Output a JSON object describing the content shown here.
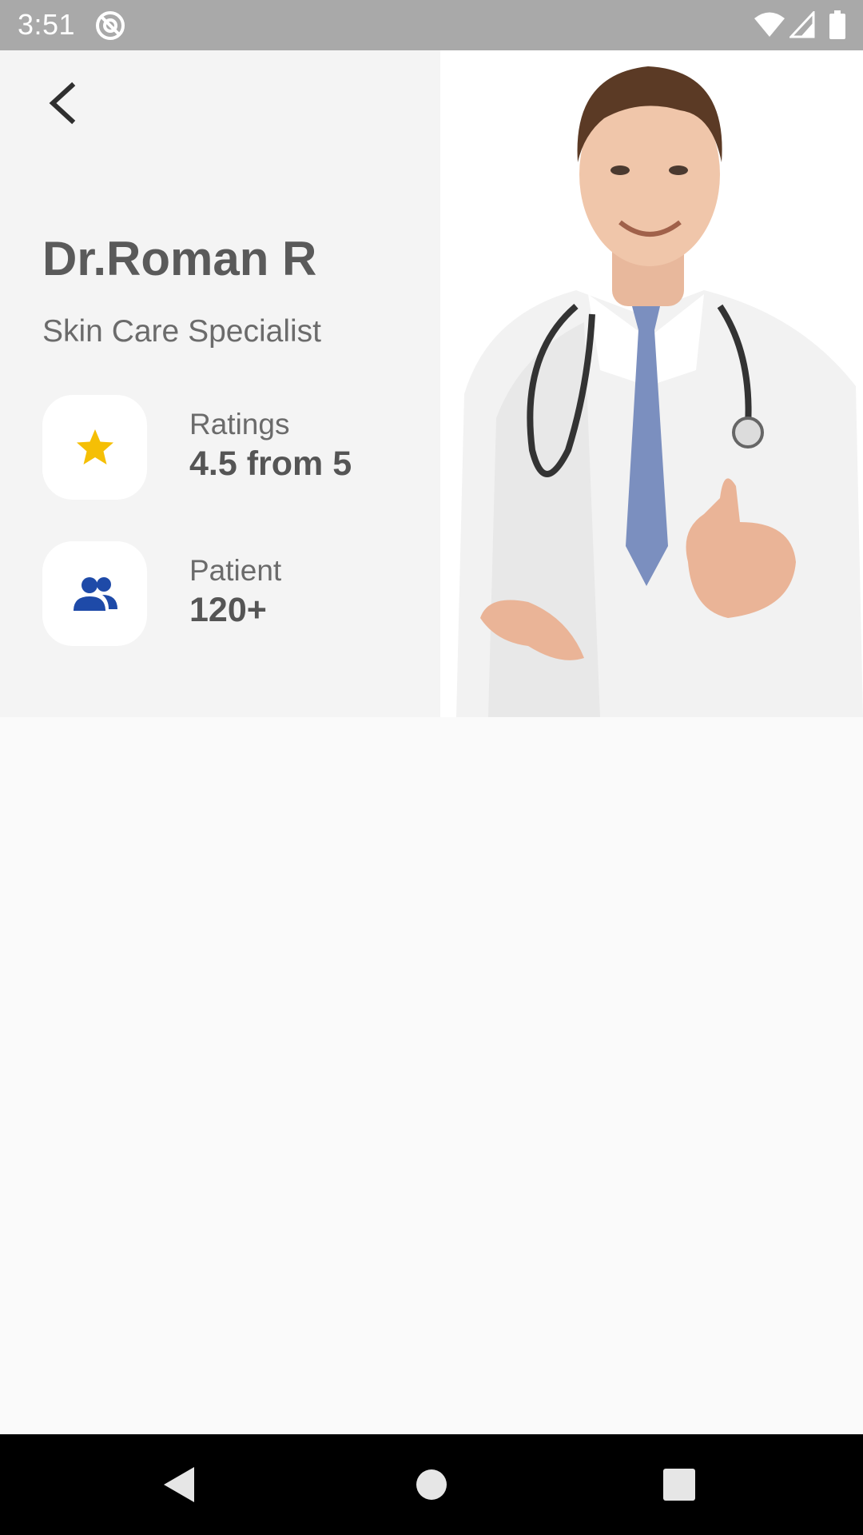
{
  "status_bar": {
    "time": "3:51",
    "icons": [
      "at-sign-icon",
      "wifi-icon",
      "signal-icon",
      "battery-icon"
    ]
  },
  "header": {
    "back_icon": "chevron-left-icon",
    "doctor_name": "Dr.Roman R",
    "specialty": "Skin Care Specialist",
    "photo": "doctor-portrait-image"
  },
  "stats": {
    "ratings": {
      "icon": "star-icon",
      "label": "Ratings",
      "value": "4.5 from 5",
      "icon_color": "#f5bf05"
    },
    "patients": {
      "icon": "people-icon",
      "label": "Patient",
      "value": "120+",
      "icon_color": "#1e4aa8"
    }
  },
  "nav_bar": {
    "buttons": [
      "back-triangle-icon",
      "home-circle-icon",
      "recents-square-icon"
    ]
  },
  "colors": {
    "status_bar": "#a9a9a9",
    "header_background": "#f4f4f4",
    "page_background": "#fafafa",
    "nav_bar": "#000000"
  }
}
